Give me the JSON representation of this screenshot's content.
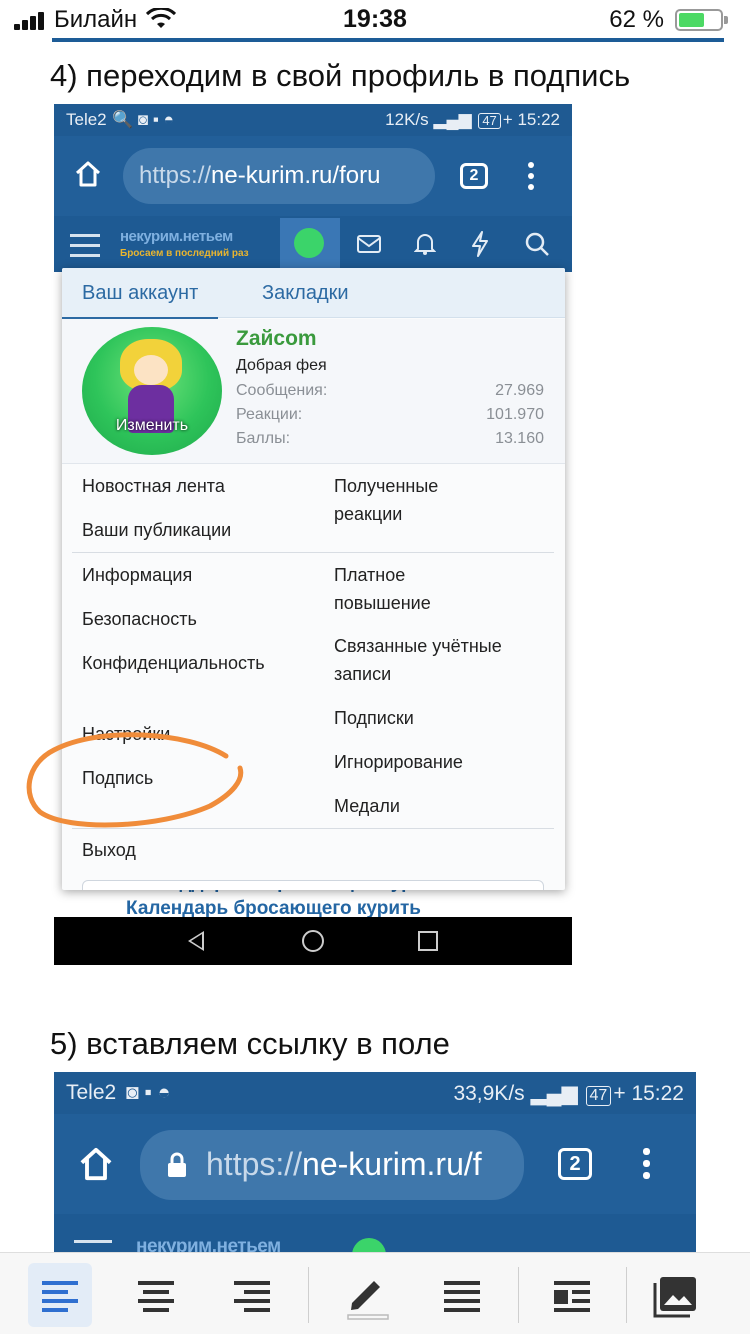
{
  "ios_status": {
    "carrier": "Билайн",
    "time": "19:38",
    "battery_percent": "62 %",
    "battery_level": 0.62
  },
  "step4": {
    "title": "4) переходим в свой профиль в подпись",
    "screenshot": {
      "status_left": "Tele2",
      "status_right": "12K/s",
      "battery_box": "47",
      "time": "15:22",
      "url_scheme": "https://",
      "url_rest": "ne-kurim.ru/foru",
      "tabs_count": "2",
      "site_logo_top": "некурим.нетьем",
      "site_logo_bottom": "Бросаем в последний раз",
      "menu": {
        "tabs": [
          "Ваш аккаунт",
          "Закладки"
        ],
        "username": "Zайcom",
        "user_title": "Добрая фея",
        "avatar_caption": "Изменить",
        "stats": [
          {
            "label": "Сообщения:",
            "value": "27.969"
          },
          {
            "label": "Реакции:",
            "value": "101.970"
          },
          {
            "label": "Баллы:",
            "value": "13.160"
          }
        ],
        "left_col_1": [
          "Новостная лента",
          "Ваши публикации"
        ],
        "right_col_1": [
          "Полученные реакции"
        ],
        "left_col_2": [
          "Информация",
          "Безопасность",
          "Конфиденциальность",
          "Настройки",
          "Подпись"
        ],
        "right_col_2": [
          "Платное повышение",
          "Связанные учётные записи",
          "Подписки",
          "Игнорирование",
          "Медали"
        ],
        "logout": "Выход"
      },
      "behind_text_1": "ім поддержки бросающих курить",
      "behind_text_2": "Календарь бросающего курить"
    }
  },
  "step5": {
    "title": "5) вставляем ссылку в поле",
    "screenshot": {
      "status_left": "Tele2",
      "status_right": "33,9K/s",
      "battery_box": "47",
      "time": "15:22",
      "url_scheme": "https://",
      "url_rest": "ne-kurim.ru/f",
      "tabs_count": "2",
      "site_logo_top": "некурим.нетьем"
    }
  },
  "toolbar": {
    "buttons": [
      "align-left-icon",
      "align-center-icon",
      "align-right-icon",
      "pencil-icon",
      "justify-icon",
      "text-wrap-icon",
      "image-gallery-icon"
    ],
    "active": "align-left-icon"
  },
  "colors": {
    "android_blue": "#1e5d96",
    "accent": "#2c6aa3",
    "annotation_orange": "#f08c3a",
    "username_green": "#3a9a3d"
  }
}
